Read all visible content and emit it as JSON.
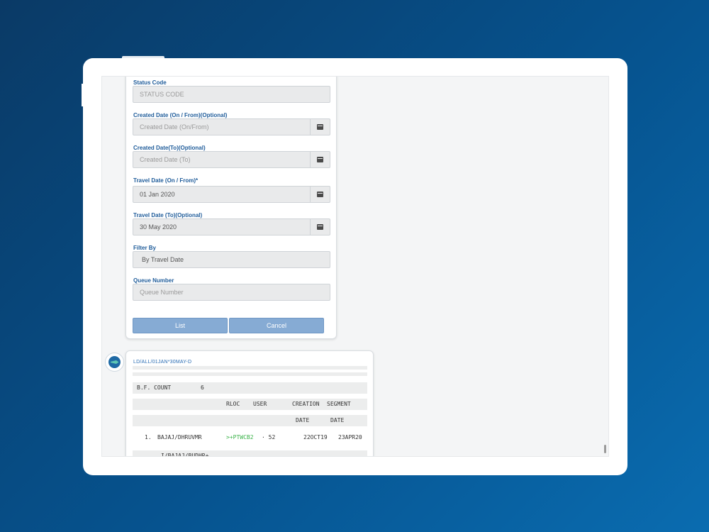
{
  "form": {
    "fields": [
      {
        "label": "Status Code",
        "placeholder": "STATUS CODE",
        "value": "",
        "has_calendar": false
      },
      {
        "label": "Created Date (On / From)(Optional)",
        "placeholder": "Created Date (On/From)",
        "value": "",
        "has_calendar": true
      },
      {
        "label": "Created Date(To)(Optional)",
        "placeholder": "Created Date (To)",
        "value": "",
        "has_calendar": true
      },
      {
        "label": "Travel Date (On / From)*",
        "placeholder": "",
        "value": "01 Jan 2020",
        "has_calendar": true
      },
      {
        "label": "Travel Date (To)(Optional)",
        "placeholder": "",
        "value": "30 May 2020",
        "has_calendar": true
      },
      {
        "label": "Filter By",
        "placeholder": "",
        "value": "By Travel Date",
        "has_calendar": false
      },
      {
        "label": "Queue Number",
        "placeholder": "Queue Number",
        "value": "",
        "has_calendar": false
      }
    ],
    "list_label": "List",
    "cancel_label": "Cancel"
  },
  "reply": {
    "command": "LD/ALL/01JAN*30MAY-D",
    "bf_count_label": "B.F. COUNT",
    "bf_count_value": "6",
    "header1": {
      "rloc": "RLOC",
      "user": "USER",
      "creation": "CREATION",
      "segment": "SEGMENT"
    },
    "header2": {
      "date1": "DATE",
      "date2": "DATE"
    },
    "entry": {
      "index": "1.",
      "name": "BAJAJ/DHRUVMR",
      "rloc": ">+PTWCB2",
      "user": "· 52",
      "creation_date": "22OCT19",
      "segment_date": "23APR20"
    },
    "next_entry": "I/BAJAJ/BUDHR+"
  },
  "colors": {
    "accent": "#1f5c9a",
    "button": "#86abd4",
    "link_green": "#3bb34a",
    "background_start": "#0a3a66",
    "background_end": "#0a6cb0"
  }
}
